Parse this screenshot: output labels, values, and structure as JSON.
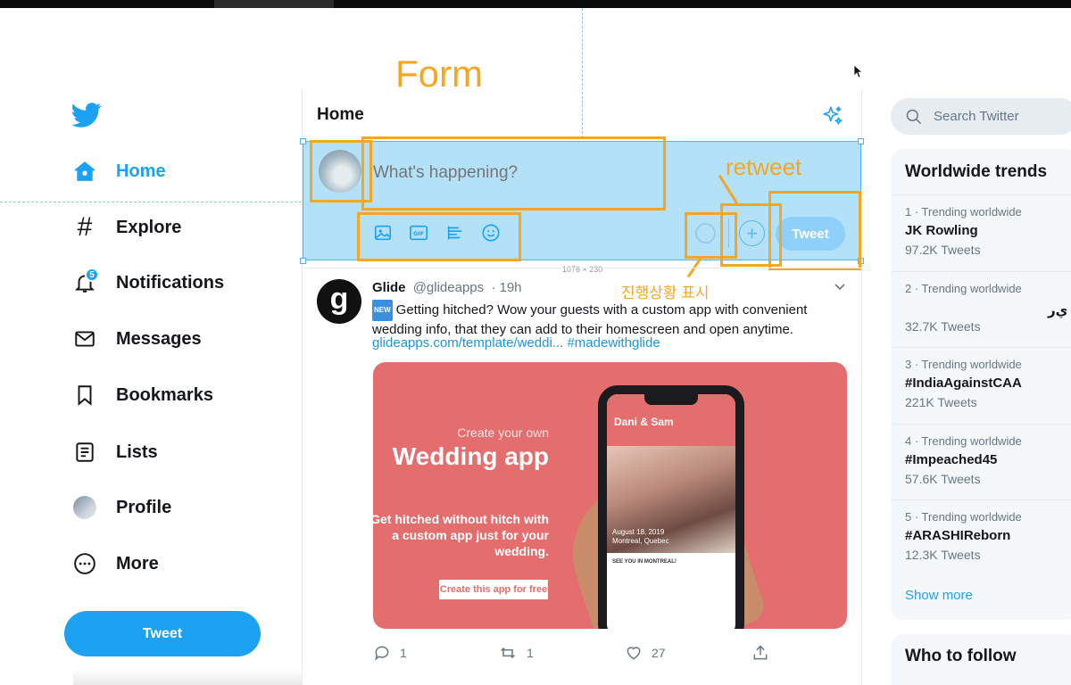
{
  "nav": {
    "items": [
      {
        "label": "Home",
        "icon": "home-icon"
      },
      {
        "label": "Explore",
        "icon": "hashtag-icon"
      },
      {
        "label": "Notifications",
        "icon": "bell-icon",
        "badge": "5"
      },
      {
        "label": "Messages",
        "icon": "envelope-icon"
      },
      {
        "label": "Bookmarks",
        "icon": "bookmark-icon"
      },
      {
        "label": "Lists",
        "icon": "list-icon"
      },
      {
        "label": "Profile",
        "icon": "avatar"
      },
      {
        "label": "More",
        "icon": "more-icon"
      }
    ],
    "tweet_button": "Tweet"
  },
  "main": {
    "title": "Home",
    "compose": {
      "placeholder": "What's happening?",
      "tweet_button": "Tweet",
      "size_label": "1076 × 230",
      "tools": [
        "image-icon",
        "gif-icon",
        "poll-icon",
        "emoji-icon"
      ],
      "progress": 0
    }
  },
  "annotations": {
    "form": "Form",
    "retweet": "retweet",
    "progress": "진행상황 표시"
  },
  "tweet": {
    "name": "Glide",
    "handle": "@glideapps",
    "time": "· 19h",
    "badge": "NEW",
    "text": "Getting hitched? Wow your guests with a custom app with convenient wedding info, that they can add to their homescreen and open anytime.",
    "link": "glideapps.com/template/weddi... #madewithglide",
    "card": {
      "subtitle": "Create your own",
      "title": "Wedding app",
      "description": "Get hitched without hitch with a custom app just for your wedding.",
      "button": "Create this app for free",
      "phone_header": "Dani & Sam",
      "phone_date": "August 18, 2019",
      "phone_place": "Montreal, Quebec",
      "phone_heading": "SEE YOU IN MONTREAL!"
    },
    "actions": {
      "replies": "1",
      "retweets": "1",
      "likes": "27"
    }
  },
  "sidebar_right": {
    "search_placeholder": "Search Twitter",
    "trends_title": "Worldwide trends",
    "trends": [
      {
        "meta": "1 · Trending worldwide",
        "name": "JK Rowling",
        "count": "97.2K Tweets"
      },
      {
        "meta": "2 · Trending worldwide",
        "name": "ﻱﺭ",
        "count": "32.7K Tweets"
      },
      {
        "meta": "3 · Trending worldwide",
        "name": "#IndiaAgainstCAA",
        "count": "221K Tweets"
      },
      {
        "meta": "4 · Trending worldwide",
        "name": "#Impeached45",
        "count": "57.6K Tweets"
      },
      {
        "meta": "5 · Trending worldwide",
        "name": "#ARASHIReborn",
        "count": "12.3K Tweets"
      }
    ],
    "show_more": "Show more",
    "who_to_follow": "Who to follow"
  },
  "colors": {
    "accent": "#1da1f2",
    "annotation": "#f5a623",
    "card": "#e46d6d"
  }
}
